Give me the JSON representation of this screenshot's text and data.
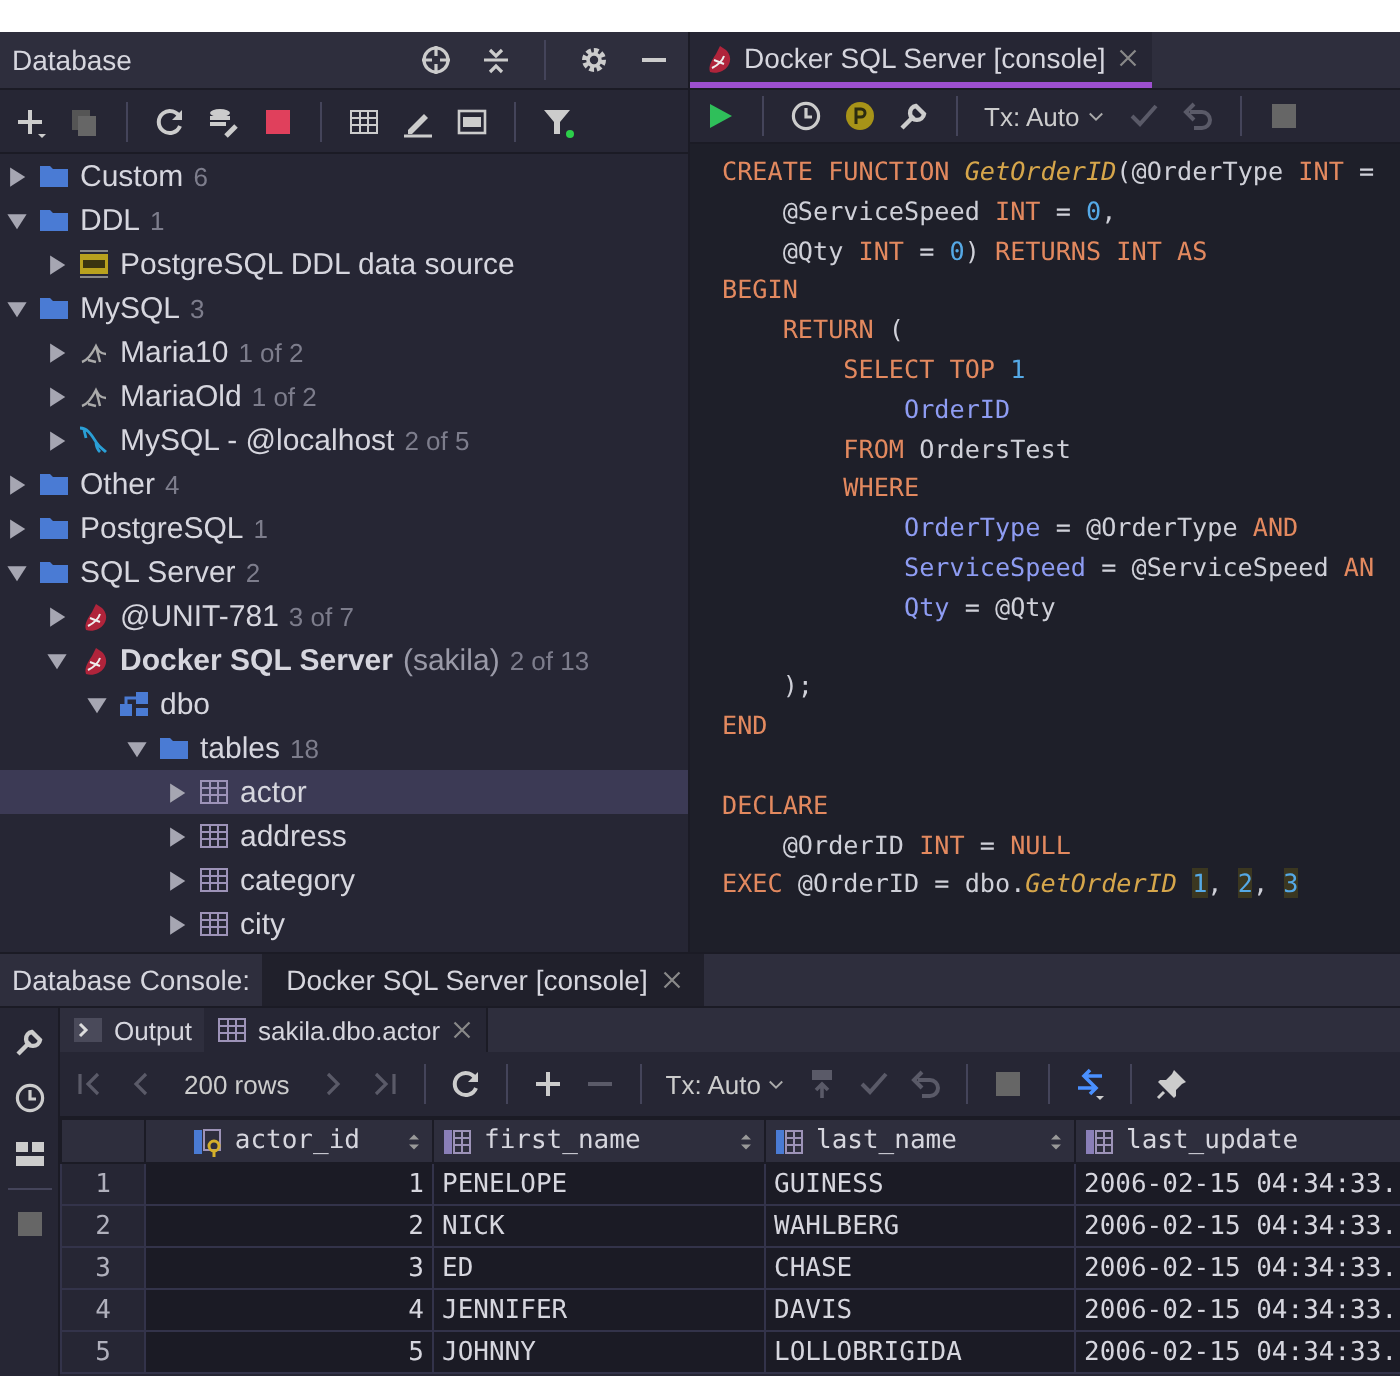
{
  "database_panel": {
    "title": "Database",
    "tree": [
      {
        "label": "Custom",
        "count": "6",
        "kind": "folder",
        "expanded": false,
        "selected": false
      },
      {
        "label": "DDL",
        "count": "1",
        "kind": "folder",
        "expanded": true,
        "selected": false,
        "children": [
          {
            "label": "PostgreSQL DDL data source",
            "kind": "ddl",
            "expanded": false,
            "selected": false
          }
        ]
      },
      {
        "label": "MySQL",
        "count": "3",
        "kind": "folder",
        "expanded": true,
        "selected": false,
        "children": [
          {
            "label": "Maria10",
            "count": "1 of 2",
            "kind": "maria",
            "expanded": false,
            "selected": false
          },
          {
            "label": "MariaOld",
            "count": "1 of 2",
            "kind": "maria",
            "expanded": false,
            "selected": false
          },
          {
            "label": "MySQL - @localhost",
            "count": "2 of 5",
            "kind": "mysql",
            "expanded": false,
            "selected": false
          }
        ]
      },
      {
        "label": "Other",
        "count": "4",
        "kind": "folder",
        "expanded": false,
        "selected": false
      },
      {
        "label": "PostgreSQL",
        "count": "1",
        "kind": "folder",
        "expanded": false,
        "selected": false
      },
      {
        "label": "SQL Server",
        "count": "2",
        "kind": "folder",
        "expanded": true,
        "selected": false,
        "children": [
          {
            "label": "@UNIT-781",
            "count": "3 of 7",
            "kind": "mssql",
            "expanded": false,
            "selected": false
          },
          {
            "label": "Docker SQL Server",
            "note": "(sakila)",
            "count": "2 of 13",
            "kind": "mssql",
            "bold": true,
            "expanded": true,
            "selected": false,
            "children": [
              {
                "label": "dbo",
                "kind": "schema",
                "expanded": true,
                "selected": false,
                "children": [
                  {
                    "label": "tables",
                    "count": "18",
                    "kind": "folder",
                    "expanded": true,
                    "selected": false,
                    "children": [
                      {
                        "label": "actor",
                        "kind": "table",
                        "expanded": false,
                        "selected": true
                      },
                      {
                        "label": "address",
                        "kind": "table",
                        "expanded": false,
                        "selected": false
                      },
                      {
                        "label": "category",
                        "kind": "table",
                        "expanded": false,
                        "selected": false
                      },
                      {
                        "label": "city",
                        "kind": "table",
                        "expanded": false,
                        "selected": false
                      }
                    ]
                  }
                ]
              }
            ]
          }
        ]
      }
    ]
  },
  "editor": {
    "tabs": [
      {
        "label": "Docker SQL Server [console]",
        "selected": true
      }
    ],
    "toolbar": {
      "tx_mode": "Tx: Auto"
    },
    "blocks": [
      [
        {
          "tokens": [
            {
              "kind": "kw",
              "text": "CREATE FUNCTION "
            },
            {
              "kind": "fn",
              "text": "GetOrderID"
            },
            {
              "kind": "plain",
              "text": "(@OrderType "
            },
            {
              "kind": "kw",
              "text": "INT"
            },
            {
              "kind": "plain",
              "text": " ="
            }
          ]
        },
        {
          "tokens": [
            {
              "kind": "plain",
              "text": "    @ServiceSpeed "
            },
            {
              "kind": "kw",
              "text": "INT"
            },
            {
              "kind": "plain",
              "text": " = "
            },
            {
              "kind": "num",
              "text": "0"
            },
            {
              "kind": "plain",
              "text": ","
            }
          ]
        },
        {
          "tokens": [
            {
              "kind": "plain",
              "text": "    @Qty "
            },
            {
              "kind": "kw",
              "text": "INT"
            },
            {
              "kind": "plain",
              "text": " = "
            },
            {
              "kind": "num",
              "text": "0"
            },
            {
              "kind": "plain",
              "text": ") "
            },
            {
              "kind": "kw",
              "text": "RETURNS INT AS"
            }
          ]
        },
        {
          "tokens": [
            {
              "kind": "kw",
              "text": "BEGIN"
            }
          ]
        },
        {
          "tokens": [
            {
              "kind": "kw",
              "text": "    RETURN"
            },
            {
              "kind": "plain",
              "text": " ("
            }
          ]
        },
        {
          "tokens": [
            {
              "kind": "kw",
              "text": "        SELECT TOP "
            },
            {
              "kind": "num",
              "text": "1"
            }
          ]
        },
        {
          "tokens": [
            {
              "kind": "col",
              "text": "            OrderID"
            }
          ]
        },
        {
          "tokens": [
            {
              "kind": "kw",
              "text": "        FROM"
            },
            {
              "kind": "plain",
              "text": " OrdersTest"
            }
          ]
        },
        {
          "tokens": [
            {
              "kind": "kw",
              "text": "        WHERE"
            }
          ]
        },
        {
          "tokens": [
            {
              "kind": "col",
              "text": "            OrderType"
            },
            {
              "kind": "plain",
              "text": " = @OrderType "
            },
            {
              "kind": "kw",
              "text": "AND"
            }
          ]
        },
        {
          "tokens": [
            {
              "kind": "col",
              "text": "            ServiceSpeed"
            },
            {
              "kind": "plain",
              "text": " = @ServiceSpeed "
            },
            {
              "kind": "kw",
              "text": "AN"
            }
          ]
        },
        {
          "tokens": [
            {
              "kind": "col",
              "text": "            Qty"
            },
            {
              "kind": "plain",
              "text": " = @Qty"
            }
          ]
        }
      ],
      [
        {
          "tokens": [
            {
              "kind": "plain",
              "text": "    );"
            }
          ]
        },
        {
          "tokens": [
            {
              "kind": "kw",
              "text": "END"
            }
          ]
        }
      ],
      [
        {
          "tokens": [
            {
              "kind": "kw",
              "text": "DECLARE"
            }
          ]
        },
        {
          "tokens": [
            {
              "kind": "plain",
              "text": "    @OrderID "
            },
            {
              "kind": "kw",
              "text": "INT"
            },
            {
              "kind": "plain",
              "text": " = "
            },
            {
              "kind": "kw",
              "text": "NULL"
            }
          ]
        },
        {
          "tokens": [
            {
              "kind": "kw",
              "text": "EXEC"
            },
            {
              "kind": "plain",
              "text": " @OrderID = dbo."
            },
            {
              "kind": "fn",
              "text": "GetOrderID "
            },
            {
              "kind": "param",
              "text": "1"
            },
            {
              "kind": "plain",
              "text": ", "
            },
            {
              "kind": "param",
              "text": "2"
            },
            {
              "kind": "plain",
              "text": ", "
            },
            {
              "kind": "param",
              "text": "3"
            }
          ]
        }
      ]
    ]
  },
  "console": {
    "title": "Database Console:",
    "tabs": [
      {
        "label": "Docker SQL Server [console]",
        "selected": true
      }
    ],
    "result_tabs": [
      {
        "label": "Output",
        "kind": "terminal",
        "closable": false,
        "selected": false
      },
      {
        "label": "sakila.dbo.actor",
        "kind": "table",
        "closable": true,
        "selected": true
      }
    ],
    "toolbar": {
      "rows": "200 rows",
      "tx_mode": "Tx: Auto"
    },
    "table": {
      "columns": [
        {
          "name": "actor_id",
          "kind": "key"
        },
        {
          "name": "first_name",
          "kind": "text"
        },
        {
          "name": "last_name",
          "kind": "text"
        },
        {
          "name": "last_update",
          "kind": "text"
        }
      ],
      "rows": [
        {
          "number": "1",
          "cells": [
            "1",
            "PENELOPE",
            "GUINESS",
            "2006-02-15 04:34:33."
          ]
        },
        {
          "number": "2",
          "cells": [
            "2",
            "NICK",
            "WAHLBERG",
            "2006-02-15 04:34:33."
          ]
        },
        {
          "number": "3",
          "cells": [
            "3",
            "ED",
            "CHASE",
            "2006-02-15 04:34:33."
          ]
        },
        {
          "number": "4",
          "cells": [
            "4",
            "JENNIFER",
            "DAVIS",
            "2006-02-15 04:34:33."
          ]
        },
        {
          "number": "5",
          "cells": [
            "5",
            "JOHNNY",
            "LOLLOBRIGIDA",
            "2006-02-15 04:34:33."
          ]
        }
      ]
    }
  }
}
